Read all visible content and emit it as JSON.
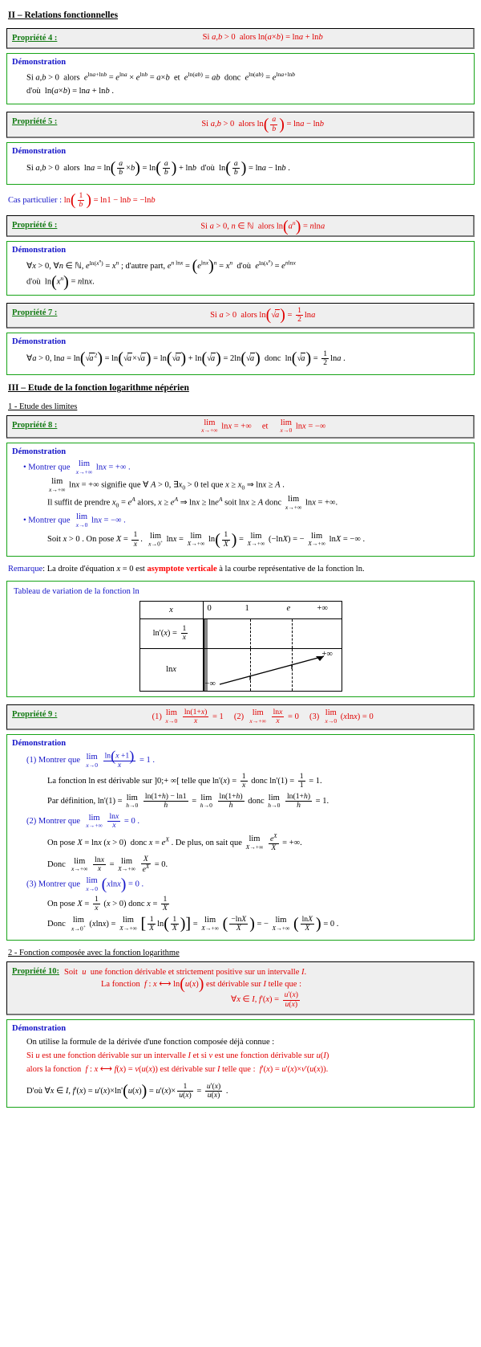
{
  "sections": {
    "two": "II – Relations fonctionnelles",
    "three": "III – Etude de la fonction logarithme népérien",
    "three_sub1": "1 - Etude des limites",
    "three_sub2": "2 - Fonction composée avec la fonction logarithme"
  },
  "labels": {
    "demonstration": "Démonstration",
    "prop4": "Propriété 4 :",
    "prop5": "Propriété 5 :",
    "prop6": "Propriété 6 :",
    "prop7": "Propriété 7 :",
    "prop8": "Propriété 8 :",
    "prop9": "Propriété 9 :",
    "prop10": "Propriété 10:"
  },
  "prop4": {
    "statement": "Si a, b > 0 alors ln(a × b) = ln a + ln b",
    "demo_line1": "Si a, b > 0 alors e^(ln a + ln b) = e^(ln a) × e^(ln b) = a × b et e^(ln(ab)) = ab donc e^(ln(ab)) = e^(ln a + ln b)",
    "demo_line2": "d'où ln(a × b) = ln a + ln b ."
  },
  "prop5": {
    "statement": "Si a, b > 0 alors ln(a/b) = ln a − ln b",
    "demo_line1": "Si a, b > 0 alors ln a = ln(a/b × b) = ln(a/b) + ln b d'où ln(a/b) = ln a − ln b .",
    "special_case_label": "Cas particulier :",
    "special_case": "ln(1/b) = ln 1 − ln b = − ln b"
  },
  "prop6": {
    "statement": "Si a > 0, n ∈ ℕ alors ln(a^n) = n ln a",
    "demo_line1": "∀x > 0, ∀n ∈ ℕ, e^(ln(x^n)) = x^n ; d'autre part, e^(n ln x) = (e^(ln x))^n = x^n d'où e^(ln(x^n)) = e^(n ln x)",
    "demo_line2": "d'où ln(x^n) = n ln x ."
  },
  "prop7": {
    "statement": "Si a > 0 alors ln(√a) = (1/2) ln a",
    "demo_line1": "∀a > 0, ln a = ln((√a)²) = ln(√a × √a) = ln(√a) + ln(√a) = 2 ln(√a) donc ln(√a) = (1/2) ln a ."
  },
  "prop8": {
    "statement_left": "lim (x→+∞) ln x = +∞",
    "statement_mid": "et",
    "statement_right": "lim (x→0) ln x = −∞",
    "bullet1": "Montrer que lim (x→+∞) ln x = +∞ .",
    "line1": "lim (x→+∞) ln x = +∞ signifie que ∀ A > 0, ∃x₀ > 0 tel que x ≥ x₀ ⇒ ln x ≥ A .",
    "line2": "Il suffit de prendre x₀ = e^A alors, x ≥ e^A ⇒ ln x ≥ ln e^A soit ln x ≥ A donc lim (x→+∞) ln x = +∞ .",
    "bullet2": "Montrer que lim (x→0) ln x = −∞ .",
    "line3": "Soit x > 0 . On pose X = 1/x . lim (x→0⁺) ln x = lim (X→+∞) ln(1/X) = lim (X→+∞) (−ln X) = − lim (X→+∞) ln X = −∞ ."
  },
  "remark": {
    "label": "Remarque",
    "text_before": ": La droite d'équation x = 0 est ",
    "highlight": "asymptote verticale",
    "text_after": " à la courbe représentative de la fonction ln."
  },
  "variation_table": {
    "title": "Tableau de variation de la fonction ln",
    "row_x_label": "x",
    "row_deriv_label": "ln'(x) = 1/x",
    "row_fn_label": "ln x",
    "x_values": [
      "0",
      "1",
      "e",
      "+∞"
    ],
    "fn_start": "−∞",
    "fn_end": "+∞"
  },
  "prop9": {
    "item1": "(1) lim (x→0) ln(1+x)/x = 1",
    "item2": "(2) lim (x→+∞) ln x / x = 0",
    "item3": "(3) lim (x→0) (x ln x) = 0",
    "demo1_title": "(1) Montrer que lim (x→0) ln(x+1)/x = 1 .",
    "demo1_line1": "La fonction ln est dérivable sur ]0; +∞[ telle que ln'(x) = 1/x donc ln'(1) = 1/1 = 1 .",
    "demo1_line2": "Par définition, ln'(1) = lim (h→0) [ln(1+h) − ln 1]/h = lim (h→0) ln(1+h)/h donc lim (h→0) ln(1+h)/h = 1 .",
    "demo2_title": "(2) Montrer que lim (x→+∞) ln x / x = 0 .",
    "demo2_line1": "On pose X = ln x (x > 0) donc x = e^X . De plus, on sait que lim (X→+∞) e^X/X = +∞ .",
    "demo2_line2": "Donc lim (x→+∞) ln x / x = lim (X→+∞) X/e^X = 0 .",
    "demo3_title": "(3) Montrer que lim (x→0) (x ln x) = 0 .",
    "demo3_line1": "On pose X = 1/x (x > 0) donc x = 1/X",
    "demo3_line2": "Donc lim (x→0⁺) (x ln x) = lim (X→+∞) [ (1/X) ln(1/X) ] = lim (X→+∞) (−ln X / X) = − lim (X→+∞) (ln X / X) = 0 ."
  },
  "prop10": {
    "line1": "Soit u une fonction dérivable et strictement positive sur un intervalle I.",
    "line2": "La fonction f : x ⟼ ln(u(x)) est dérivable sur I telle que :",
    "line3": "∀x ∈ I, f'(x) = u'(x)/u(x)",
    "demo_line1": "On utilise la formule de la dérivée d'une fonction composée déjà connue :",
    "demo_line2": "Si u est une fonction dérivable sur un intervalle I et si v est une fonction dérivable sur u(I)",
    "demo_line3": "alors la fonction f : x ⟼ f(x) = v(u(x)) est dérivable sur I telle que : f'(x) = u'(x) × v'(u(x)).",
    "demo_line4": "D'où ∀x ∈ I, f'(x) = u'(x) × ln'(u(x)) = u'(x) × 1/u(x) = u'(x)/u(x) ."
  }
}
